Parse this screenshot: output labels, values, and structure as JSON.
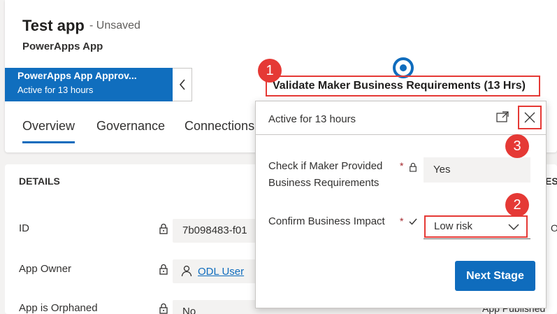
{
  "header": {
    "title": "Test app",
    "status": "- Unsaved",
    "entity": "PowerApps App"
  },
  "bpf": {
    "name": "PowerApps App Approv...",
    "active": "Active for 13 hours",
    "stage_label": "Validate Maker Business Requirements  (13 Hrs)"
  },
  "tabs": [
    {
      "label": "Overview"
    },
    {
      "label": "Governance"
    },
    {
      "label": "Connections"
    }
  ],
  "details": {
    "title": "DETAILS",
    "rows": [
      {
        "label": "ID",
        "value": "7b098483-f01"
      },
      {
        "label": "App Owner",
        "value": "ODL User"
      },
      {
        "label": "App is Orphaned",
        "value": "No"
      }
    ]
  },
  "right_fragments": {
    "top": "ES",
    "mid": "O",
    "bottom": "App Published"
  },
  "flyout": {
    "active": "Active for 13 hours",
    "fields": [
      {
        "label": "Check if Maker Provided Business Requirements",
        "value": "Yes"
      },
      {
        "label": "Confirm Business Impact",
        "value": "Low risk"
      }
    ],
    "next_button": "Next Stage"
  },
  "callouts": [
    "1",
    "2",
    "3"
  ],
  "colors": {
    "accent": "#0f6cbd",
    "bpf_pill": "#106ebe",
    "highlight": "#e53935"
  }
}
